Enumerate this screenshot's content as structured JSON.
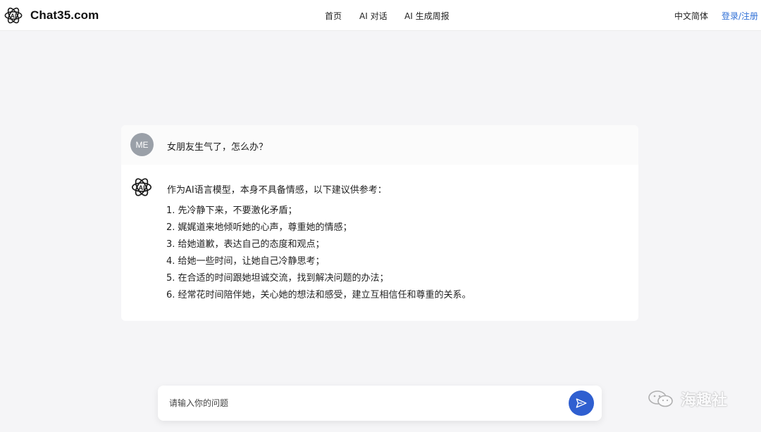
{
  "brand": {
    "name": "Chat35.com",
    "logo_icon": "openai-knot-icon"
  },
  "nav": {
    "items": [
      "首页",
      "AI 对话",
      "AI 生成周报"
    ]
  },
  "header_right": {
    "language": "中文简体",
    "login": "登录/注册"
  },
  "conversation": {
    "user": {
      "avatar_text": "ME",
      "message": "女朋友生气了，怎么办？"
    },
    "assistant": {
      "avatar_icon": "openai-knot-icon",
      "intro": "作为AI语言模型，本身不具备情感，以下建议供参考：",
      "items": [
        "1. 先冷静下来，不要激化矛盾；",
        "2. 娓娓道来地倾听她的心声，尊重她的情感；",
        "3. 给她道歉，表达自己的态度和观点；",
        "4. 给她一些时间，让她自己冷静思考；",
        "5. 在合适的时间跟她坦诚交流，找到解决问题的办法；",
        "6. 经常花时间陪伴她，关心她的想法和感受，建立互相信任和尊重的关系。"
      ]
    }
  },
  "composer": {
    "placeholder": "请输入你的问题",
    "send_icon": "send-icon"
  },
  "watermark": {
    "text": "海趣社",
    "icon": "wechat-icon"
  },
  "colors": {
    "accent": "#2f5fd0",
    "link": "#2f6fd6",
    "avatar": "#9aa0a8",
    "background": "#f5f5f7"
  }
}
